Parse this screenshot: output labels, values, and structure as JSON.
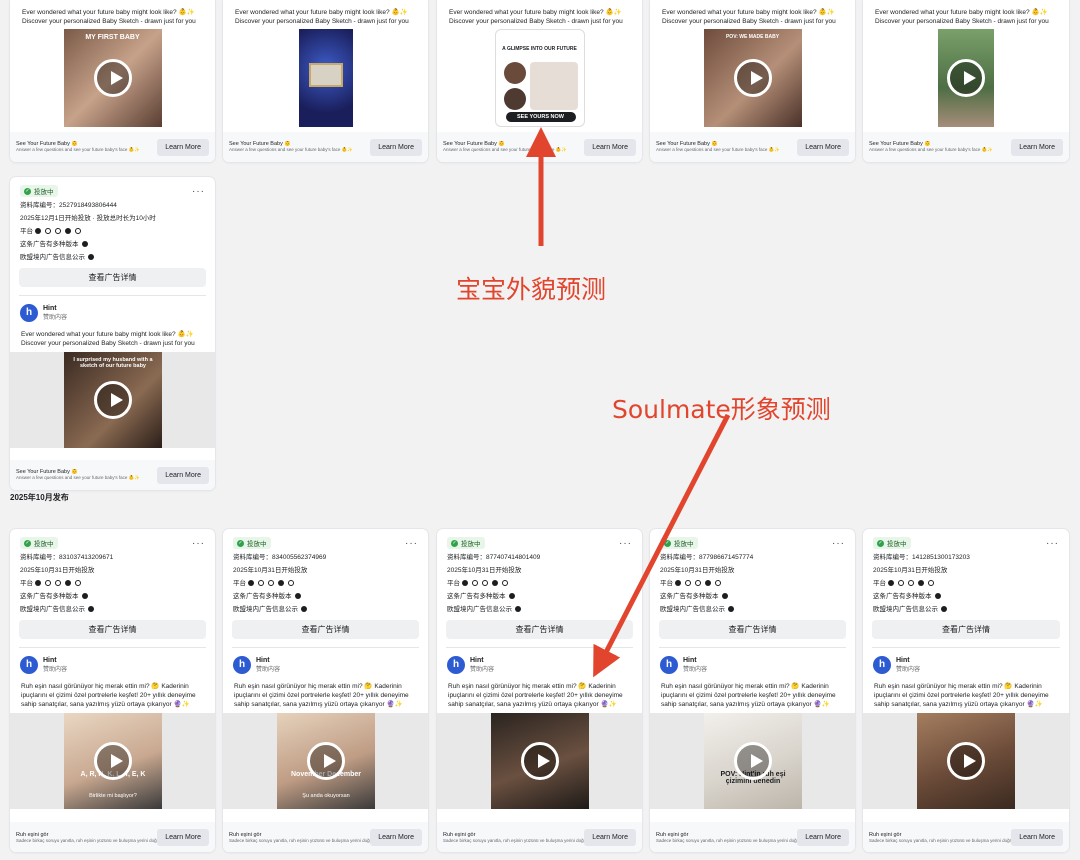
{
  "common": {
    "en_text": "Ever wondered what your future baby might look like? 👶✨ Discover your personalized Baby Sketch - drawn just for you",
    "cta_title": "See Your Future Baby 👶",
    "cta_desc": "Answer a few questions and see your future baby's face 👶✨",
    "learn_more": "Learn More",
    "status": "投放中",
    "details_btn": "查看广告详情",
    "multi_version": "这条广告有多种版本",
    "eu_transparency": "欧盟境内广告信息公示",
    "platform_label": "平台",
    "advertiser": "Hint",
    "sponsored": "赞助内容",
    "tr_text": "Ruh eşin nasıl görünüyor hiç merak ettin mi? 🤔 Kaderinin ipuçlarını el çizimi özel portrelerle keşfet! 20+ yıllık deneyime sahip sanatçılar, sana yazılmış yüzü ortaya çıkarıyor 🔮✨",
    "tr_cta_title": "Ruh eşini gör",
    "tr_cta_desc": "Sadece birkaç soruyu yanıtla, ruh eşinin yüzünü ve buluşma yerini doğru şekilde çizelim",
    "more": "···"
  },
  "top_row_overlays": [
    "MY FIRST BABY",
    "",
    "A GLIMPSE INTO OUR FUTURE",
    "POV: WE MADE BABY",
    ""
  ],
  "top_row_button_see_yours": "SEE YOURS NOW",
  "mid_card": {
    "id_label": "资料库编号：2527918493806444",
    "date": "2025年12月1日开始投放 · 投放总时长为10小时",
    "overlay": "I surprised my husband with a sketch of our future baby"
  },
  "section_label": "2025年10月发布",
  "bottom_cards": [
    {
      "id_label": "资料库编号：831037413209671",
      "date": "2025年10月31日开始投放",
      "overlay": "A, R, H, K, L, T, E, K",
      "overlay2": "Birlikte mi başlıyor?"
    },
    {
      "id_label": "资料库编号：834005562374969",
      "date": "2025年10月31日开始投放",
      "overlay": "November December",
      "overlay2": "Şu anda okuyorsan"
    },
    {
      "id_label": "资料库编号：877407414801409",
      "date": "2025年10月31日开始投放",
      "overlay": "",
      "overlay2": ""
    },
    {
      "id_label": "资料库编号：877986671457774",
      "date": "2025年10月31日开始投放",
      "overlay": "POV: Hint'in ruh eşi çizimini denedin",
      "overlay2": ""
    },
    {
      "id_label": "资料库编号：1412851300173203",
      "date": "2025年10月31日开始投放",
      "overlay": "",
      "overlay2": ""
    }
  ],
  "annotations": {
    "baby": "宝宝外貌预测",
    "soulmate": "Soulmate形象预测",
    "color": "#e2452d"
  }
}
